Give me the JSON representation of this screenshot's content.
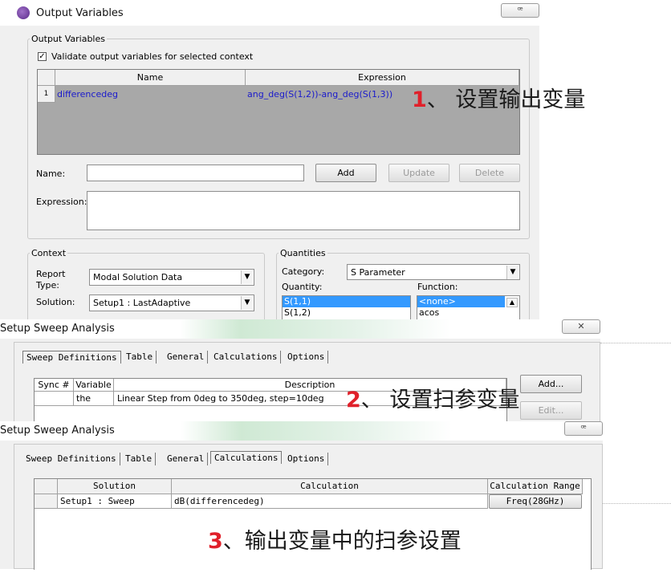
{
  "win1": {
    "title": "Output Variables",
    "output_group": "Output Variables",
    "validate_label": "Validate output variables for selected context",
    "validate_checked": true,
    "table": {
      "headers": [
        "Name",
        "Expression"
      ],
      "rows": [
        {
          "num": "1",
          "name": "differencedeg",
          "expression": "ang_deg(S(1,2))-ang_deg(S(1,3))"
        }
      ]
    },
    "name_label": "Name:",
    "expression_label": "Expression:",
    "add_btn": "Add",
    "update_btn": "Update",
    "delete_btn": "Delete",
    "context": {
      "legend": "Context",
      "report_type_label": "Report Type:",
      "report_type_value": "Modal Solution Data",
      "solution_label": "Solution:",
      "solution_value": "Setup1 : LastAdaptive"
    },
    "quantities": {
      "legend": "Quantities",
      "category_label": "Category:",
      "category_value": "S Parameter",
      "quantity_label": "Quantity:",
      "function_label": "Function:",
      "quantity_items": [
        "S(1,1)",
        "S(1,2)"
      ],
      "function_items": [
        "<none>",
        "acos"
      ]
    }
  },
  "win2": {
    "title": "Setup Sweep Analysis",
    "tabs": [
      "Sweep Definitions",
      "Table",
      "General",
      "Calculations",
      "Options"
    ],
    "columns": [
      "Sync #",
      "Variable",
      "Description"
    ],
    "rows": [
      {
        "sync": "",
        "variable": "the",
        "description": "Linear Step from 0deg to 350deg, step=10deg"
      }
    ],
    "add_btn": "Add...",
    "edit_btn": "Edit..."
  },
  "win3": {
    "title": "Setup Sweep Analysis",
    "tabs": [
      "Sweep Definitions",
      "Table",
      "General",
      "Calculations",
      "Options"
    ],
    "columns": [
      "Solution",
      "Calculation",
      "Calculation Range"
    ],
    "rows": [
      {
        "solution": "Setup1 : Sweep",
        "calculation": "dB(differencedeg)",
        "range": "Freq(28GHz)"
      }
    ]
  },
  "annotations": {
    "a1_num": "1",
    "a1_text": "、 设置输出变量",
    "a2_num": "2",
    "a2_text": "、 设置扫参变量",
    "a3_num": "3",
    "a3_text": "、输出变量中的扫参设置"
  },
  "colors": {
    "selection": "#3399ff",
    "expression_text": "#1a1acc",
    "annotation_number": "#e0202a",
    "window_bg": "#f0f0f0"
  }
}
